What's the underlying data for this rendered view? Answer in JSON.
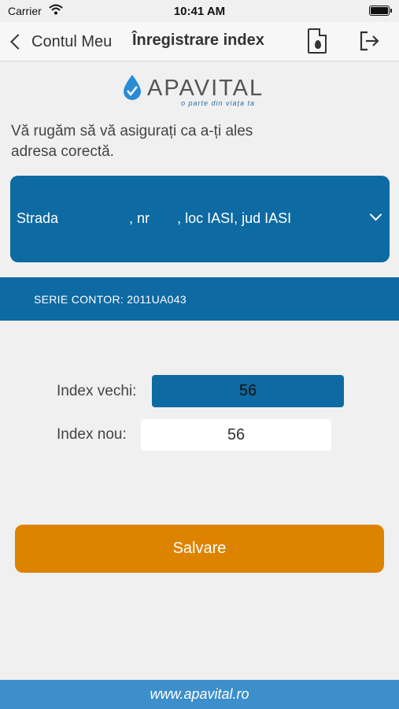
{
  "status_bar": {
    "carrier": "Carrier",
    "time": "10:41 AM"
  },
  "nav": {
    "back_label": "Contul Meu",
    "title": "Înregistrare index",
    "icons": [
      "chevron-left-icon",
      "document-drop-icon",
      "logout-icon"
    ]
  },
  "logo": {
    "brand": "APAVITAL",
    "tagline": "o parte din viața ta"
  },
  "instruction": "Vă rugăm să vă asigurați ca a-ți ales adresa corectă.",
  "address": {
    "selected": "Strada                  , nr       , loc IASI, jud IASI"
  },
  "meter": {
    "serial_label": "SERIE CONTOR: 2011UA043"
  },
  "index": {
    "old_label": "Index vechi:",
    "old_value": "56",
    "new_label": "Index nou:",
    "new_value": "56"
  },
  "save_label": "Salvare",
  "footer": {
    "url": "www.apavital.ro"
  },
  "colors": {
    "primary_blue": "#0e6aa2",
    "footer_blue": "#3d8fcb",
    "save_orange": "#dd8300",
    "background": "#f0f0f0"
  }
}
